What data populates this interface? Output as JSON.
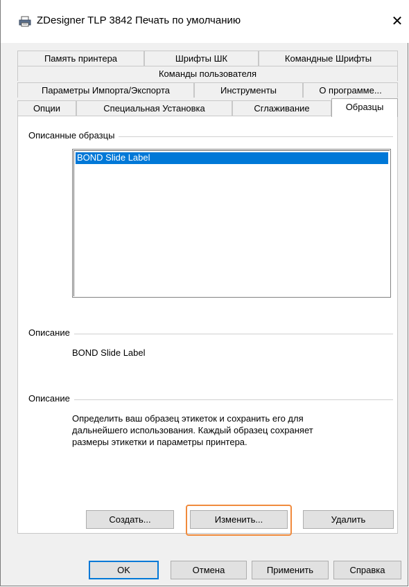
{
  "window": {
    "title": "ZDesigner TLP 3842 Печать по умолчанию",
    "icon": "printer-icon",
    "close_glyph": "✕"
  },
  "tabs": {
    "row1": [
      "Память принтера",
      "Шрифты ШК",
      "Командные Шрифты"
    ],
    "row2": [
      "Команды пользователя"
    ],
    "row3": [
      "Параметры Импорта/Экспорта",
      "Инструменты",
      "О программе..."
    ],
    "row4": [
      "Опции",
      "Специальная Установка",
      "Сглаживание",
      "Образцы"
    ],
    "active": "Образцы"
  },
  "panel": {
    "samples_group": "Описанные образцы",
    "samples": [
      "BOND Slide Label"
    ],
    "selected_sample": "BOND Slide Label",
    "description1_group": "Описание",
    "description1_text": "BOND Slide Label",
    "description2_group": "Описание",
    "description2_lines": [
      "Определить ваш образец этикеток и сохранить его для",
      "дальнейшего использования. Каждый образец сохраняет",
      "размеры этикетки и параметры принтера."
    ],
    "buttons": {
      "create": "Создать...",
      "edit": "Изменить...",
      "delete": "Удалить"
    }
  },
  "footer": {
    "ok": "OK",
    "cancel": "Отмена",
    "apply": "Применить",
    "help": "Справка"
  },
  "colors": {
    "selection": "#0078d7",
    "highlight_outline": "#f08a3c"
  }
}
